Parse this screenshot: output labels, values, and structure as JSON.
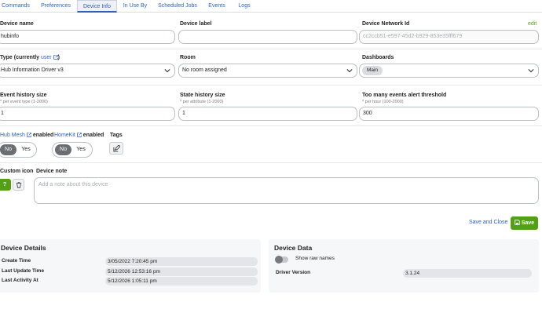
{
  "tabs": [
    {
      "label": "Commands"
    },
    {
      "label": "Preferences"
    },
    {
      "label": "Device Info"
    },
    {
      "label": "In Use By"
    },
    {
      "label": "Scheduled Jobs"
    },
    {
      "label": "Events"
    },
    {
      "label": "Logs"
    }
  ],
  "active_tab": "Device Info",
  "device_name": {
    "label": "Device name",
    "value": "hubinfo"
  },
  "device_label": {
    "label": "Device label",
    "value": ""
  },
  "network_id": {
    "label": "Device Network Id",
    "edit": "edit",
    "value": "cc2ccb51-e597-45d2-b929-853e35fff679"
  },
  "type": {
    "label_prefix": "Type (currently ",
    "link": "user",
    "label_suffix": ")",
    "value": "Hub Information Driver v3"
  },
  "room": {
    "label": "Room",
    "value": "No room assigned"
  },
  "dashboards": {
    "label": "Dashboards",
    "chip": "Main"
  },
  "event_history": {
    "label": "Event history size",
    "hint": "* per event type (1-2000)",
    "value": "1"
  },
  "state_history": {
    "label": "State history size",
    "hint": "* per attribute (1-2000)",
    "value": "1"
  },
  "alert_threshold": {
    "label": "Too many events alert threshold",
    "hint": "* per hour (100-2000)",
    "value": "300"
  },
  "hub_mesh": {
    "link": "Hub Mesh",
    "label": "enabled",
    "no": "No",
    "yes": "Yes",
    "selected": "No"
  },
  "homekit": {
    "link": "HomeKit",
    "label": "enabled",
    "no": "No",
    "yes": "Yes",
    "selected": "No"
  },
  "tags": {
    "label": "Tags"
  },
  "custom_icon": {
    "label": "Custom icon",
    "glyph": "?"
  },
  "device_note": {
    "label": "Device note",
    "placeholder": "Add a note about this device"
  },
  "actions": {
    "save_close": "Save and Close",
    "save": "Save"
  },
  "device_details": {
    "title": "Device Details",
    "rows": [
      {
        "label": "Create Time",
        "value": "3/05/2022 7:20:45 pm"
      },
      {
        "label": "Last Update Time",
        "value": "5/12/2026 12:53:16 pm"
      },
      {
        "label": "Last Activity At",
        "value": "5/12/2026 1:05:11 pm"
      }
    ]
  },
  "device_data": {
    "title": "Device Data",
    "show_raw": "Show raw names",
    "rows": [
      {
        "label": "Driver Version",
        "value": "3.1.24"
      }
    ]
  },
  "colors": {
    "accent": "#2d62b8",
    "green": "#52a014",
    "edit_link": "#5aa414"
  }
}
